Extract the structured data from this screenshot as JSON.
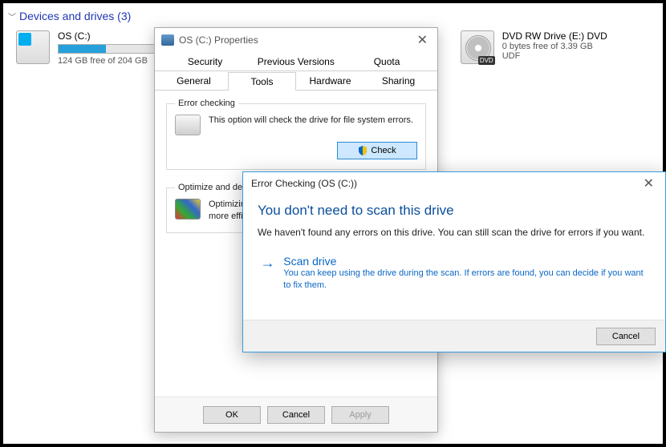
{
  "section": {
    "title": "Devices and drives (3)"
  },
  "drives": {
    "os": {
      "title": "OS (C:)",
      "sub": "124 GB free of 204 GB",
      "fill_pct": 40
    },
    "dvd": {
      "title": "DVD RW Drive (E:) DVD",
      "sub": "0 bytes free of 3.39 GB",
      "fs": "UDF"
    }
  },
  "props": {
    "title": "OS (C:) Properties",
    "tabs_row1": {
      "security": "Security",
      "prev": "Previous Versions",
      "quota": "Quota"
    },
    "tabs_row2": {
      "general": "General",
      "tools": "Tools",
      "hardware": "Hardware",
      "sharing": "Sharing"
    },
    "errgroup": {
      "legend": "Error checking",
      "desc": "This option will check the drive for file system errors.",
      "check_btn": "Check"
    },
    "optgroup": {
      "legend_full": "Optimize and defragment drive",
      "legend_visible": "Optimize and def",
      "desc_full": "Optimizing your computer's drives can help it run more efficiently.",
      "desc_visible_line1": "Optimizin",
      "desc_visible_line2": "more effi"
    },
    "footer": {
      "ok": "OK",
      "cancel": "Cancel",
      "apply": "Apply"
    }
  },
  "errdlg": {
    "title": "Error Checking (OS (C:))",
    "heading": "You don't need to scan this drive",
    "body": "We haven't found any errors on this drive. You can still scan the drive for errors if you want.",
    "option": {
      "title": "Scan drive",
      "sub": "You can keep using the drive during the scan. If errors are found, you can decide if you want to fix them."
    },
    "cancel": "Cancel"
  }
}
